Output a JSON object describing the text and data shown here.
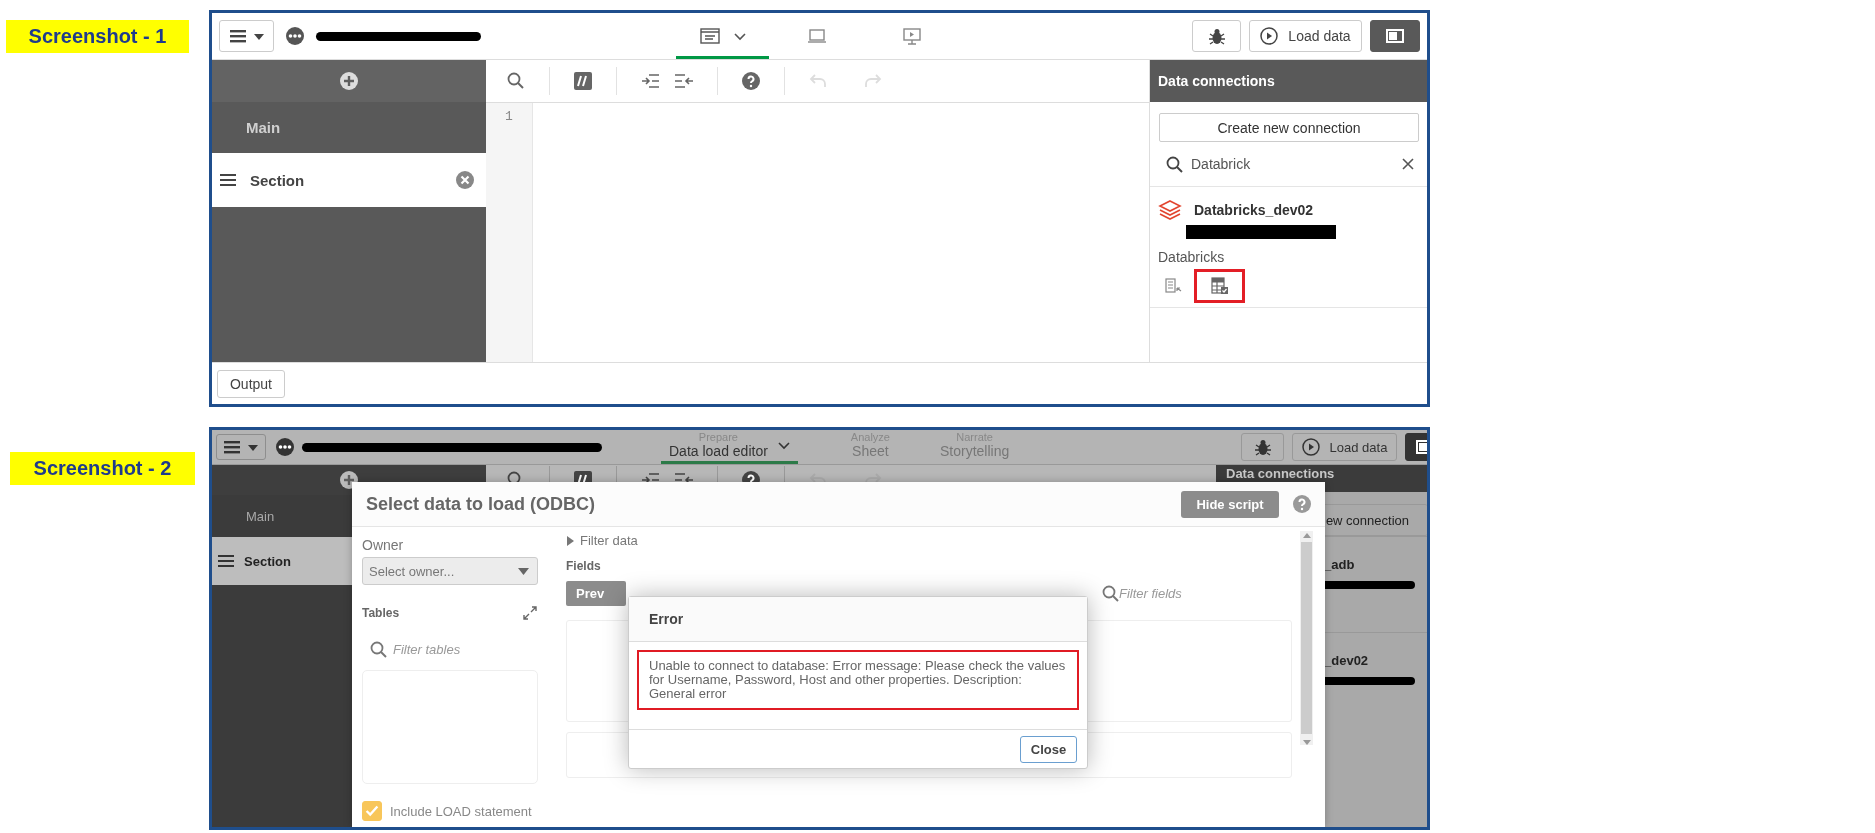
{
  "screenshot_1": {
    "caption": "Screenshot - 1",
    "title_redacted": true,
    "view_tabs": [
      {
        "kind": "data-load-editor",
        "selected": true
      },
      {
        "kind": "sheet",
        "selected": false
      },
      {
        "kind": "storytelling",
        "selected": false
      }
    ],
    "load_button": "Load data",
    "sections": [
      {
        "label": "Main",
        "selected": false
      },
      {
        "label": "Section",
        "selected": true,
        "closable": true
      }
    ],
    "editor_toolbar": [
      {
        "kind": "search",
        "disabled": false
      },
      {
        "kind": "comment",
        "disabled": false
      },
      {
        "kind": "indent",
        "disabled": false
      },
      {
        "kind": "outdent",
        "disabled": false
      },
      {
        "kind": "help",
        "disabled": false
      },
      {
        "kind": "undo",
        "disabled": true
      },
      {
        "kind": "redo",
        "disabled": true
      }
    ],
    "line_numbers": [
      "1"
    ],
    "data_connections": {
      "title": "Data connections",
      "create_button": "Create new connection",
      "search": {
        "value": "Databrick"
      },
      "connections": [
        {
          "name": "Databricks_dev02",
          "subtitle_redacted": true
        }
      ],
      "group_label": "Databricks",
      "actions": [
        {
          "kind": "select-data",
          "highlighted": false
        },
        {
          "kind": "table",
          "highlighted": true
        }
      ]
    },
    "output_button": "Output"
  },
  "screenshot_2": {
    "caption": "Screenshot - 2",
    "title_redacted": true,
    "view_tabs": [
      {
        "overline": "Prepare",
        "label": "Data load editor",
        "selected": true
      },
      {
        "overline": "Analyze",
        "label": "Sheet",
        "selected": false
      },
      {
        "overline": "Narrate",
        "label": "Storytelling",
        "selected": false
      }
    ],
    "load_button": "Load data",
    "sections": [
      {
        "label": "Main",
        "selected": false
      },
      {
        "label": "Section",
        "selected": true
      }
    ],
    "editor_toolbar": [
      {
        "kind": "search",
        "disabled": false
      },
      {
        "kind": "comment",
        "disabled": false
      },
      {
        "kind": "indent",
        "disabled": false
      },
      {
        "kind": "outdent",
        "disabled": false
      },
      {
        "kind": "help",
        "disabled": false
      },
      {
        "kind": "undo",
        "disabled": true
      },
      {
        "kind": "redo",
        "disabled": true
      }
    ],
    "data_connections": {
      "title": "Data connections",
      "create_button": "ew connection",
      "connections": [
        {
          "name": "_adb",
          "subtitle_redacted": true
        },
        {
          "name": "_dev02",
          "subtitle_redacted": true
        }
      ]
    },
    "dialog": {
      "title": "Select data to load (ODBC)",
      "hide_script_button": "Hide script",
      "owner_label": "Owner",
      "owner_select": {
        "placeholder": "Select owner..."
      },
      "tables_label": "Tables",
      "filter_tables": {
        "placeholder": "Filter tables"
      },
      "filter_data": "Filter data",
      "fields_label": "Fields",
      "preview_button": "Prev",
      "filter_fields": {
        "placeholder": "Filter fields"
      },
      "include_load": {
        "label": "Include LOAD statement",
        "checked": true
      }
    },
    "error": {
      "title": "Error",
      "message": "Unable to connect to database: Error message: Please check the values for Username, Password, Host and other properties. Description: General error",
      "message_highlighted": true,
      "close_button": "Close"
    }
  }
}
